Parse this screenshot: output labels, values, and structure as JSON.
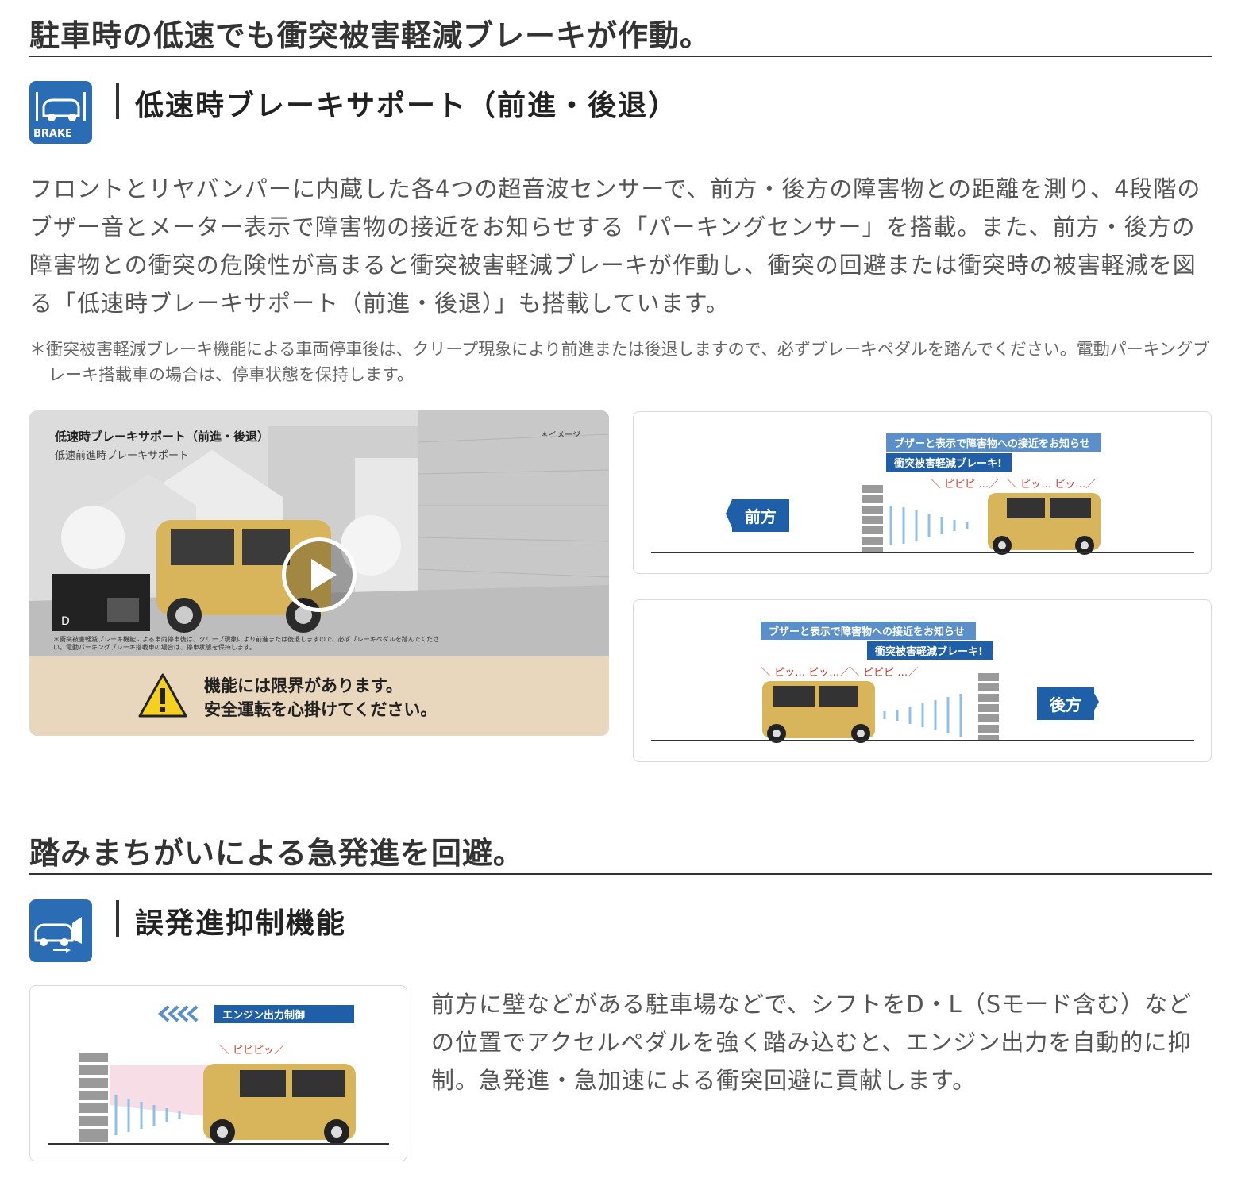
{
  "section1": {
    "title": "駐車時の低速でも衝突被害軽減ブレーキが作動。",
    "feature_title": "低速時ブレーキサポート（前進・後退）",
    "icon_label": "BRAKE",
    "body": "フロントとリヤバンパーに内蔵した各4つの超音波センサーで、前方・後方の障害物との距離を測り、4段階のブザー音とメーター表示で障害物の接近をお知らせする「パーキングセンサー」を搭載。また、前方・後方の障害物との衝突の危険性が高まると衝突被害軽減ブレーキが作動し、衝突の回避または衝突時の被害軽減を図る「低速時ブレーキサポート（前進・後退）」も搭載しています。",
    "note": "＊衝突被害軽減ブレーキ機能による車両停車後は、クリープ現象により前進または後退しますので、必ずブレーキペダルを踏んでください。電動パーキングブレーキ搭載車の場合は、停車状態を保持します。",
    "video": {
      "title": "低速時ブレーキサポート（前進・後退）",
      "subtitle": "低速前進時ブレーキサポート",
      "tag": "＊イメージ",
      "fine": "＊衝突被害軽減ブレーキ機能による車両停車後は、クリープ現象により前進または後退しますので、必ずブレーキペダルを踏んでください。電動パーキングブレーキ搭載車の場合は、停車状態を保持します。",
      "warning_line1": "機能には限界があります。",
      "warning_line2": "安全運転を心掛けてください。"
    },
    "diagram_front": {
      "tag1": "ブザーと表示で障害物への接近をお知らせ",
      "tag2": "衝突被害軽減ブレーキ!",
      "beep1": "＼ ピピピ …／",
      "beep2": "＼ ピッ… ピッ…／",
      "direction": "前方"
    },
    "diagram_rear": {
      "tag1": "ブザーと表示で障害物への接近をお知らせ",
      "tag2": "衝突被害軽減ブレーキ!",
      "beep1": "＼ ピッ… ピッ…／",
      "beep2": "＼ ピピピ …／",
      "direction": "後方"
    }
  },
  "section2": {
    "title": "踏みまちがいによる急発進を回避。",
    "feature_title": "誤発進抑制機能",
    "diagram": {
      "tag": "エンジン出力制御",
      "beep": "＼ ピピピッ／"
    },
    "body": "前方に壁などがある駐車場などで、シフトをD・L（Sモード含む）などの位置でアクセルペダルを強く踏み込むと、エンジン出力を自動的に抑制。急発進・急加速による衝突回避に貢献します。"
  },
  "colors": {
    "accent_blue": "#2a6db5",
    "car_yellow": "#d8b45a",
    "warning_beige": "#e9d7bd"
  }
}
